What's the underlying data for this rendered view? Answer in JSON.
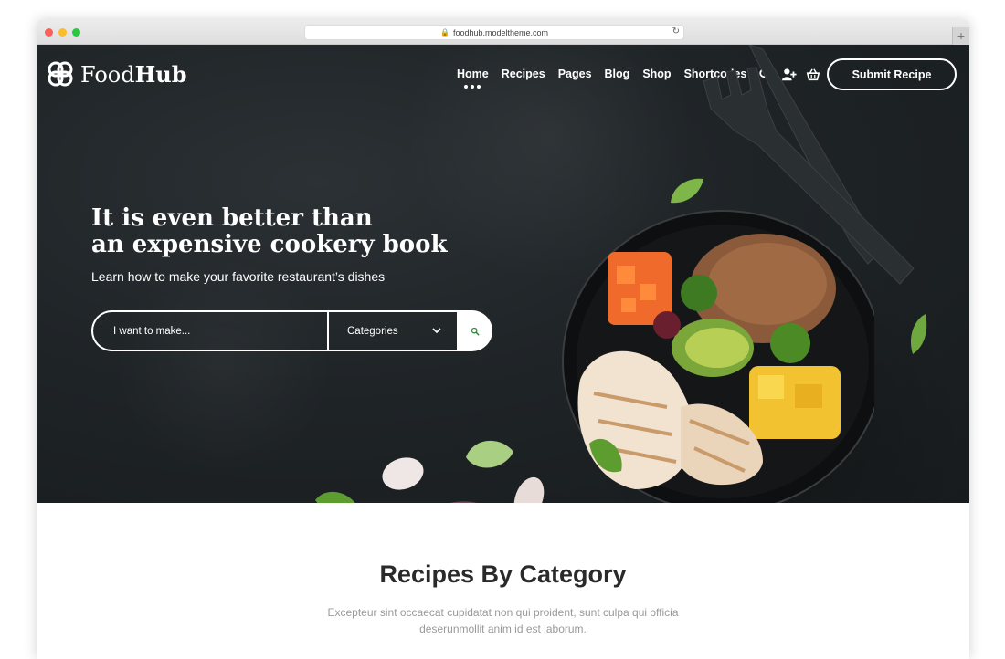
{
  "browser": {
    "url": "foodhub.modeltheme.com"
  },
  "brand": {
    "name_light": "Food",
    "name_bold": "Hub",
    "accent": "#2e8b3a"
  },
  "nav": {
    "items": [
      {
        "label": "Home",
        "active": true
      },
      {
        "label": "Recipes",
        "active": false
      },
      {
        "label": "Pages",
        "active": false
      },
      {
        "label": "Blog",
        "active": false
      },
      {
        "label": "Shop",
        "active": false
      },
      {
        "label": "Shortcodes",
        "active": false
      }
    ],
    "icons": [
      "search-icon",
      "add-user-icon",
      "basket-icon"
    ],
    "submit_label": "Submit Recipe"
  },
  "hero": {
    "headline_line1": "It is even better than",
    "headline_line2": "an expensive cookery book",
    "subline": "Learn how to make your favorite restaurant’s dishes",
    "search": {
      "placeholder": "I want to make...",
      "category_selected": "Categories"
    }
  },
  "section": {
    "title": "Recipes By Category",
    "description_line1": "Excepteur sint occaecat cupidatat non qui proident, sunt culpa qui officia",
    "description_line2": "deserunmollit anim id est laborum."
  }
}
